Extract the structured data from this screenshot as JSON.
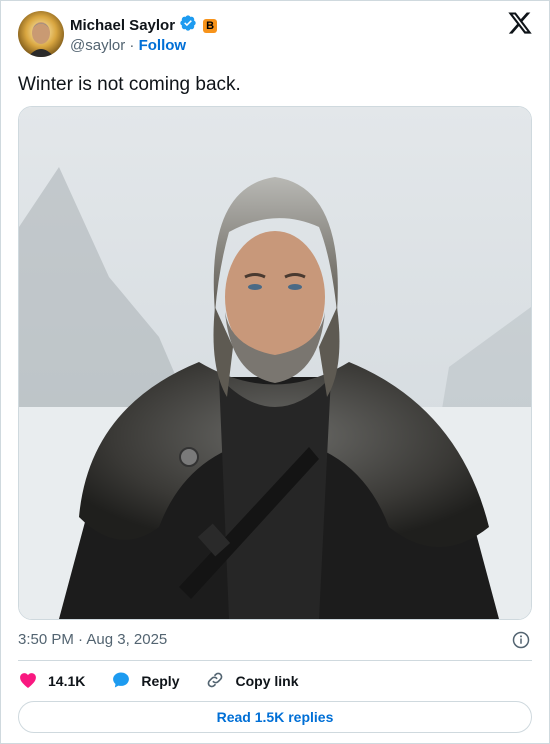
{
  "tweet": {
    "author_name": "Michael Saylor",
    "badge_letter": "B",
    "handle": "@saylor",
    "separator": "·",
    "follow_label": "Follow",
    "text": "Winter is not coming back.",
    "timestamp": "3:50 PM · Aug 3, 2025"
  },
  "actions": {
    "likes": "14.1K",
    "reply_label": "Reply",
    "copy_label": "Copy link",
    "read_replies_label": "Read 1.5K replies"
  },
  "colors": {
    "accent": "#006fd6",
    "like": "#f91880",
    "verified": "#1d9bf0",
    "bitcoin_badge": "#f7931a"
  },
  "icons": [
    "verified-icon",
    "x-logo-icon",
    "info-icon",
    "heart-icon",
    "reply-bubble-icon",
    "link-icon"
  ]
}
